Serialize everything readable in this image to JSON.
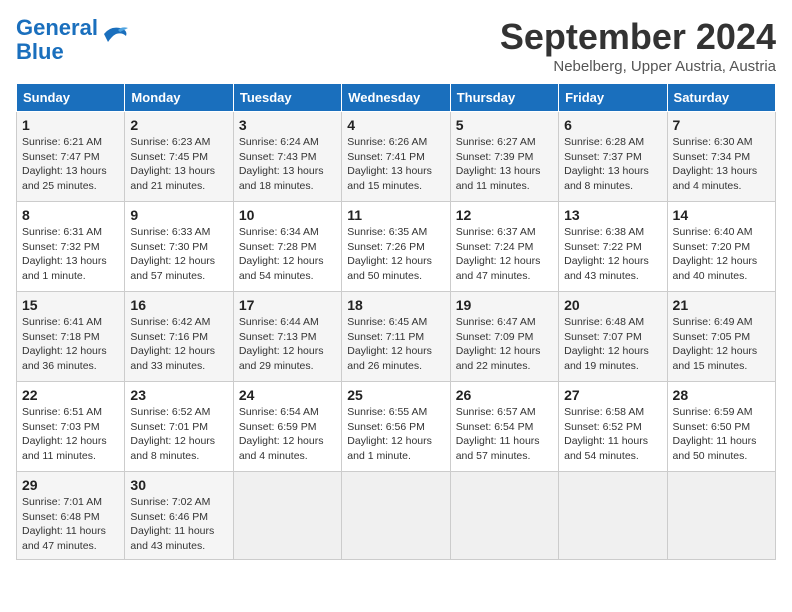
{
  "header": {
    "logo_line1": "General",
    "logo_line2": "Blue",
    "month_title": "September 2024",
    "location": "Nebelberg, Upper Austria, Austria"
  },
  "weekdays": [
    "Sunday",
    "Monday",
    "Tuesday",
    "Wednesday",
    "Thursday",
    "Friday",
    "Saturday"
  ],
  "weeks": [
    [
      {
        "day": "1",
        "info": "Sunrise: 6:21 AM\nSunset: 7:47 PM\nDaylight: 13 hours\nand 25 minutes."
      },
      {
        "day": "2",
        "info": "Sunrise: 6:23 AM\nSunset: 7:45 PM\nDaylight: 13 hours\nand 21 minutes."
      },
      {
        "day": "3",
        "info": "Sunrise: 6:24 AM\nSunset: 7:43 PM\nDaylight: 13 hours\nand 18 minutes."
      },
      {
        "day": "4",
        "info": "Sunrise: 6:26 AM\nSunset: 7:41 PM\nDaylight: 13 hours\nand 15 minutes."
      },
      {
        "day": "5",
        "info": "Sunrise: 6:27 AM\nSunset: 7:39 PM\nDaylight: 13 hours\nand 11 minutes."
      },
      {
        "day": "6",
        "info": "Sunrise: 6:28 AM\nSunset: 7:37 PM\nDaylight: 13 hours\nand 8 minutes."
      },
      {
        "day": "7",
        "info": "Sunrise: 6:30 AM\nSunset: 7:34 PM\nDaylight: 13 hours\nand 4 minutes."
      }
    ],
    [
      {
        "day": "8",
        "info": "Sunrise: 6:31 AM\nSunset: 7:32 PM\nDaylight: 13 hours\nand 1 minute."
      },
      {
        "day": "9",
        "info": "Sunrise: 6:33 AM\nSunset: 7:30 PM\nDaylight: 12 hours\nand 57 minutes."
      },
      {
        "day": "10",
        "info": "Sunrise: 6:34 AM\nSunset: 7:28 PM\nDaylight: 12 hours\nand 54 minutes."
      },
      {
        "day": "11",
        "info": "Sunrise: 6:35 AM\nSunset: 7:26 PM\nDaylight: 12 hours\nand 50 minutes."
      },
      {
        "day": "12",
        "info": "Sunrise: 6:37 AM\nSunset: 7:24 PM\nDaylight: 12 hours\nand 47 minutes."
      },
      {
        "day": "13",
        "info": "Sunrise: 6:38 AM\nSunset: 7:22 PM\nDaylight: 12 hours\nand 43 minutes."
      },
      {
        "day": "14",
        "info": "Sunrise: 6:40 AM\nSunset: 7:20 PM\nDaylight: 12 hours\nand 40 minutes."
      }
    ],
    [
      {
        "day": "15",
        "info": "Sunrise: 6:41 AM\nSunset: 7:18 PM\nDaylight: 12 hours\nand 36 minutes."
      },
      {
        "day": "16",
        "info": "Sunrise: 6:42 AM\nSunset: 7:16 PM\nDaylight: 12 hours\nand 33 minutes."
      },
      {
        "day": "17",
        "info": "Sunrise: 6:44 AM\nSunset: 7:13 PM\nDaylight: 12 hours\nand 29 minutes."
      },
      {
        "day": "18",
        "info": "Sunrise: 6:45 AM\nSunset: 7:11 PM\nDaylight: 12 hours\nand 26 minutes."
      },
      {
        "day": "19",
        "info": "Sunrise: 6:47 AM\nSunset: 7:09 PM\nDaylight: 12 hours\nand 22 minutes."
      },
      {
        "day": "20",
        "info": "Sunrise: 6:48 AM\nSunset: 7:07 PM\nDaylight: 12 hours\nand 19 minutes."
      },
      {
        "day": "21",
        "info": "Sunrise: 6:49 AM\nSunset: 7:05 PM\nDaylight: 12 hours\nand 15 minutes."
      }
    ],
    [
      {
        "day": "22",
        "info": "Sunrise: 6:51 AM\nSunset: 7:03 PM\nDaylight: 12 hours\nand 11 minutes."
      },
      {
        "day": "23",
        "info": "Sunrise: 6:52 AM\nSunset: 7:01 PM\nDaylight: 12 hours\nand 8 minutes."
      },
      {
        "day": "24",
        "info": "Sunrise: 6:54 AM\nSunset: 6:59 PM\nDaylight: 12 hours\nand 4 minutes."
      },
      {
        "day": "25",
        "info": "Sunrise: 6:55 AM\nSunset: 6:56 PM\nDaylight: 12 hours\nand 1 minute."
      },
      {
        "day": "26",
        "info": "Sunrise: 6:57 AM\nSunset: 6:54 PM\nDaylight: 11 hours\nand 57 minutes."
      },
      {
        "day": "27",
        "info": "Sunrise: 6:58 AM\nSunset: 6:52 PM\nDaylight: 11 hours\nand 54 minutes."
      },
      {
        "day": "28",
        "info": "Sunrise: 6:59 AM\nSunset: 6:50 PM\nDaylight: 11 hours\nand 50 minutes."
      }
    ],
    [
      {
        "day": "29",
        "info": "Sunrise: 7:01 AM\nSunset: 6:48 PM\nDaylight: 11 hours\nand 47 minutes."
      },
      {
        "day": "30",
        "info": "Sunrise: 7:02 AM\nSunset: 6:46 PM\nDaylight: 11 hours\nand 43 minutes."
      },
      {
        "day": "",
        "info": ""
      },
      {
        "day": "",
        "info": ""
      },
      {
        "day": "",
        "info": ""
      },
      {
        "day": "",
        "info": ""
      },
      {
        "day": "",
        "info": ""
      }
    ]
  ]
}
